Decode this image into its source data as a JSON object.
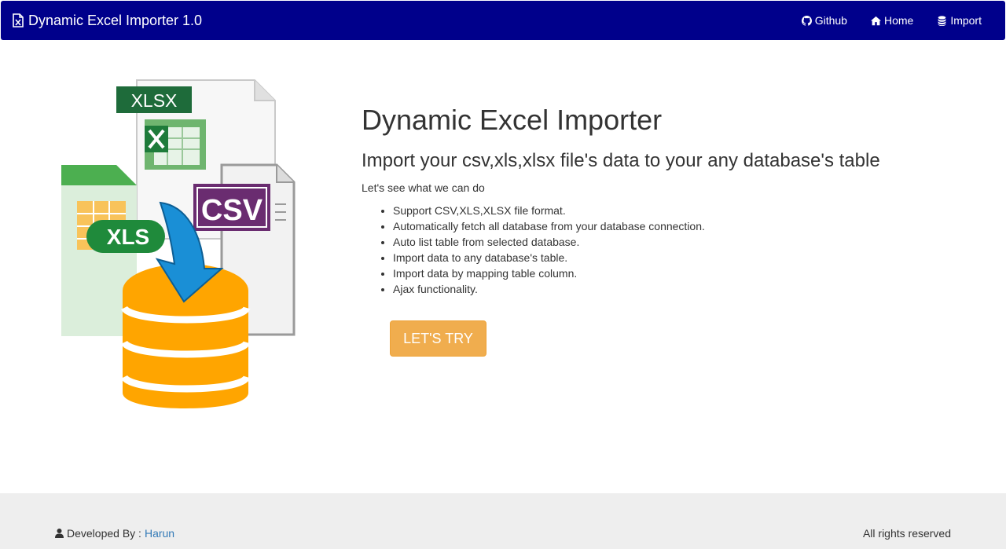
{
  "navbar": {
    "brand_icon": "excel-file-icon",
    "brand": "Dynamic Excel Importer 1.0",
    "links": [
      {
        "label": "Github",
        "icon": "github-icon"
      },
      {
        "label": "Home",
        "icon": "home-icon"
      },
      {
        "label": "Import",
        "icon": "database-icon"
      }
    ]
  },
  "illustration": {
    "labels": {
      "xlsx": "XLSX",
      "csv": "CSV",
      "xls": "XLS"
    }
  },
  "main": {
    "title": "Dynamic Excel Importer",
    "subtitle": "Import your csv,xls,xlsx file's data to your any database's table",
    "intro": "Let's see what we can do",
    "features": [
      "Support CSV,XLS,XLSX file format.",
      "Automatically fetch all database from your database connection.",
      "Auto list table from selected database.",
      "Import data to any database's table.",
      "Import data by mapping table column.",
      "Ajax functionality."
    ],
    "cta_label": "LET'S TRY"
  },
  "footer": {
    "developed_by": "Developed By :",
    "developer": "Harun",
    "rights": "All rights reserved"
  },
  "colors": {
    "navbar": "#00008b",
    "cta": "#f0ad4e",
    "footer_bg": "#eeeeee",
    "link": "#337ab7",
    "database": "#ffa500"
  }
}
